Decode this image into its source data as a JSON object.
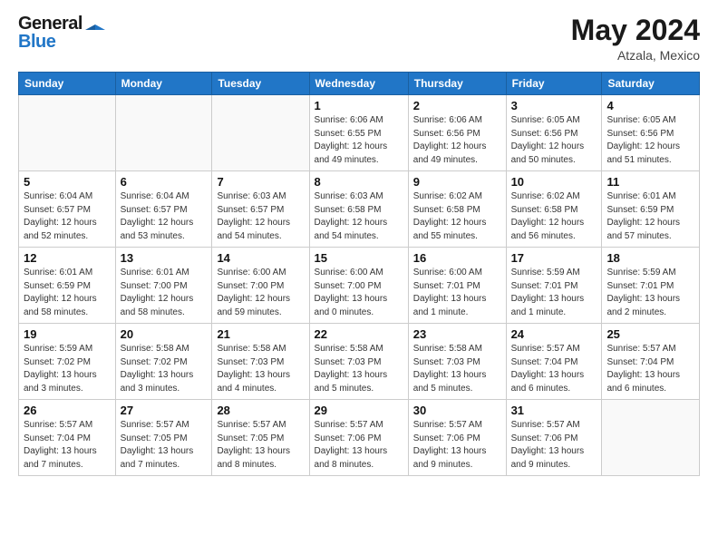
{
  "header": {
    "logo_top": "General",
    "logo_bot": "Blue",
    "month_year": "May 2024",
    "location": "Atzala, Mexico"
  },
  "weekdays": [
    "Sunday",
    "Monday",
    "Tuesday",
    "Wednesday",
    "Thursday",
    "Friday",
    "Saturday"
  ],
  "weeks": [
    [
      {
        "day": "",
        "info": ""
      },
      {
        "day": "",
        "info": ""
      },
      {
        "day": "",
        "info": ""
      },
      {
        "day": "1",
        "info": "Sunrise: 6:06 AM\nSunset: 6:55 PM\nDaylight: 12 hours\nand 49 minutes."
      },
      {
        "day": "2",
        "info": "Sunrise: 6:06 AM\nSunset: 6:56 PM\nDaylight: 12 hours\nand 49 minutes."
      },
      {
        "day": "3",
        "info": "Sunrise: 6:05 AM\nSunset: 6:56 PM\nDaylight: 12 hours\nand 50 minutes."
      },
      {
        "day": "4",
        "info": "Sunrise: 6:05 AM\nSunset: 6:56 PM\nDaylight: 12 hours\nand 51 minutes."
      }
    ],
    [
      {
        "day": "5",
        "info": "Sunrise: 6:04 AM\nSunset: 6:57 PM\nDaylight: 12 hours\nand 52 minutes."
      },
      {
        "day": "6",
        "info": "Sunrise: 6:04 AM\nSunset: 6:57 PM\nDaylight: 12 hours\nand 53 minutes."
      },
      {
        "day": "7",
        "info": "Sunrise: 6:03 AM\nSunset: 6:57 PM\nDaylight: 12 hours\nand 54 minutes."
      },
      {
        "day": "8",
        "info": "Sunrise: 6:03 AM\nSunset: 6:58 PM\nDaylight: 12 hours\nand 54 minutes."
      },
      {
        "day": "9",
        "info": "Sunrise: 6:02 AM\nSunset: 6:58 PM\nDaylight: 12 hours\nand 55 minutes."
      },
      {
        "day": "10",
        "info": "Sunrise: 6:02 AM\nSunset: 6:58 PM\nDaylight: 12 hours\nand 56 minutes."
      },
      {
        "day": "11",
        "info": "Sunrise: 6:01 AM\nSunset: 6:59 PM\nDaylight: 12 hours\nand 57 minutes."
      }
    ],
    [
      {
        "day": "12",
        "info": "Sunrise: 6:01 AM\nSunset: 6:59 PM\nDaylight: 12 hours\nand 58 minutes."
      },
      {
        "day": "13",
        "info": "Sunrise: 6:01 AM\nSunset: 7:00 PM\nDaylight: 12 hours\nand 58 minutes."
      },
      {
        "day": "14",
        "info": "Sunrise: 6:00 AM\nSunset: 7:00 PM\nDaylight: 12 hours\nand 59 minutes."
      },
      {
        "day": "15",
        "info": "Sunrise: 6:00 AM\nSunset: 7:00 PM\nDaylight: 13 hours\nand 0 minutes."
      },
      {
        "day": "16",
        "info": "Sunrise: 6:00 AM\nSunset: 7:01 PM\nDaylight: 13 hours\nand 1 minute."
      },
      {
        "day": "17",
        "info": "Sunrise: 5:59 AM\nSunset: 7:01 PM\nDaylight: 13 hours\nand 1 minute."
      },
      {
        "day": "18",
        "info": "Sunrise: 5:59 AM\nSunset: 7:01 PM\nDaylight: 13 hours\nand 2 minutes."
      }
    ],
    [
      {
        "day": "19",
        "info": "Sunrise: 5:59 AM\nSunset: 7:02 PM\nDaylight: 13 hours\nand 3 minutes."
      },
      {
        "day": "20",
        "info": "Sunrise: 5:58 AM\nSunset: 7:02 PM\nDaylight: 13 hours\nand 3 minutes."
      },
      {
        "day": "21",
        "info": "Sunrise: 5:58 AM\nSunset: 7:03 PM\nDaylight: 13 hours\nand 4 minutes."
      },
      {
        "day": "22",
        "info": "Sunrise: 5:58 AM\nSunset: 7:03 PM\nDaylight: 13 hours\nand 5 minutes."
      },
      {
        "day": "23",
        "info": "Sunrise: 5:58 AM\nSunset: 7:03 PM\nDaylight: 13 hours\nand 5 minutes."
      },
      {
        "day": "24",
        "info": "Sunrise: 5:57 AM\nSunset: 7:04 PM\nDaylight: 13 hours\nand 6 minutes."
      },
      {
        "day": "25",
        "info": "Sunrise: 5:57 AM\nSunset: 7:04 PM\nDaylight: 13 hours\nand 6 minutes."
      }
    ],
    [
      {
        "day": "26",
        "info": "Sunrise: 5:57 AM\nSunset: 7:04 PM\nDaylight: 13 hours\nand 7 minutes."
      },
      {
        "day": "27",
        "info": "Sunrise: 5:57 AM\nSunset: 7:05 PM\nDaylight: 13 hours\nand 7 minutes."
      },
      {
        "day": "28",
        "info": "Sunrise: 5:57 AM\nSunset: 7:05 PM\nDaylight: 13 hours\nand 8 minutes."
      },
      {
        "day": "29",
        "info": "Sunrise: 5:57 AM\nSunset: 7:06 PM\nDaylight: 13 hours\nand 8 minutes."
      },
      {
        "day": "30",
        "info": "Sunrise: 5:57 AM\nSunset: 7:06 PM\nDaylight: 13 hours\nand 9 minutes."
      },
      {
        "day": "31",
        "info": "Sunrise: 5:57 AM\nSunset: 7:06 PM\nDaylight: 13 hours\nand 9 minutes."
      },
      {
        "day": "",
        "info": ""
      }
    ]
  ]
}
